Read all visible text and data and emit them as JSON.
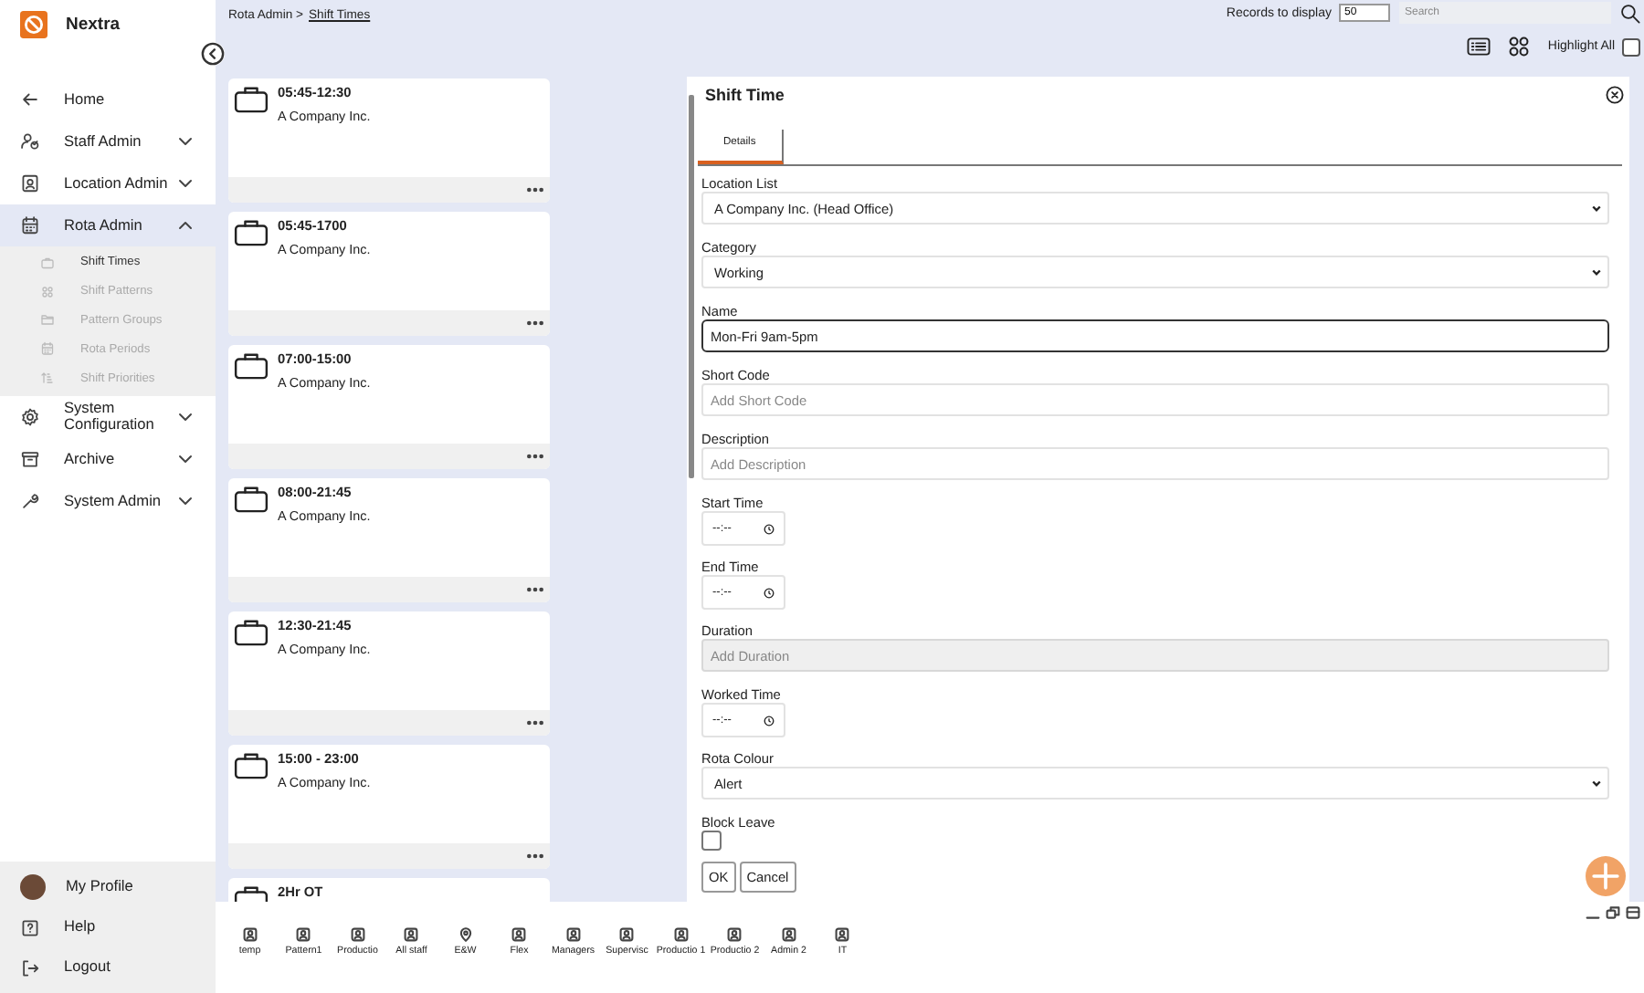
{
  "brand": {
    "name": "Nextra"
  },
  "sidebar": {
    "items": [
      {
        "label": "Home",
        "selected": false
      },
      {
        "label": "Staff Admin",
        "expanded": false,
        "selected": false
      },
      {
        "label": "Location Admin",
        "expanded": false,
        "selected": false
      },
      {
        "label": "Rota Admin",
        "expanded": true,
        "selected": true,
        "children": [
          {
            "label": "Shift Times",
            "selected": true
          },
          {
            "label": "Shift Patterns",
            "selected": false
          },
          {
            "label": "Pattern Groups",
            "selected": false
          },
          {
            "label": "Rota Periods",
            "selected": false
          },
          {
            "label": "Shift Priorities",
            "selected": false
          }
        ]
      },
      {
        "label": "System Configuration",
        "expanded": false,
        "selected": false
      },
      {
        "label": "Archive",
        "expanded": false,
        "selected": false
      },
      {
        "label": "System Admin",
        "expanded": false,
        "selected": false
      }
    ],
    "footer": [
      {
        "label": "My Profile"
      },
      {
        "label": "Help"
      },
      {
        "label": "Logout"
      }
    ]
  },
  "breadcrumb": {
    "parent": "Rota Admin >",
    "current": "Shift Times"
  },
  "toolbar": {
    "records_label": "Records to display",
    "records_value": "50",
    "search_placeholder": "Search",
    "highlight_label": "Highlight All",
    "highlight_checked": false
  },
  "shift_cards": [
    {
      "title": "05:45-12:30",
      "company": "A Company Inc."
    },
    {
      "title": "05:45-1700",
      "company": "A Company Inc."
    },
    {
      "title": "07:00-15:00",
      "company": "A Company Inc."
    },
    {
      "title": "08:00-21:45",
      "company": "A Company Inc."
    },
    {
      "title": "12:30-21:45",
      "company": "A Company Inc."
    },
    {
      "title": "15:00 - 23:00",
      "company": "A Company Inc."
    },
    {
      "title": "2Hr OT"
    }
  ],
  "panel": {
    "title": "Shift Time",
    "tabs": [
      {
        "label": "Details",
        "selected": true
      }
    ],
    "fields": [
      {
        "label": "Location List",
        "kind": "select",
        "value": "A Company Inc. (Head Office)"
      },
      {
        "label": "Category",
        "kind": "select",
        "value": "Working"
      },
      {
        "label": "Name",
        "kind": "text",
        "value": "Mon-Fri 9am-5pm",
        "focused": true
      },
      {
        "label": "Short Code",
        "kind": "text",
        "placeholder": "Add Short Code"
      },
      {
        "label": "Description",
        "kind": "text",
        "placeholder": "Add Description"
      },
      {
        "label": "Start Time",
        "kind": "time",
        "value": "--:--"
      },
      {
        "label": "End Time",
        "kind": "time",
        "value": "--:--"
      },
      {
        "label": "Duration",
        "kind": "text",
        "placeholder": "Add Duration",
        "disabled": true
      },
      {
        "label": "Worked Time",
        "kind": "time",
        "value": "--:--"
      },
      {
        "label": "Rota Colour",
        "kind": "select",
        "value": "Alert"
      },
      {
        "label": "Block Leave",
        "kind": "checkbox",
        "checked": false
      }
    ],
    "buttons": [
      "OK",
      "Cancel"
    ]
  },
  "shortcuts": [
    {
      "label": "temp",
      "kind": "person"
    },
    {
      "label": "Pattern1",
      "kind": "person"
    },
    {
      "label": "Productio",
      "kind": "person"
    },
    {
      "label": "All staff",
      "kind": "person"
    },
    {
      "label": "E&W",
      "kind": "location"
    },
    {
      "label": "Flex",
      "kind": "person"
    },
    {
      "label": "Managers",
      "kind": "person"
    },
    {
      "label": "Supervisc",
      "kind": "person"
    },
    {
      "label": "Productio 1",
      "kind": "person"
    },
    {
      "label": "Productio 2",
      "kind": "person"
    },
    {
      "label": "Admin 2",
      "kind": "person"
    },
    {
      "label": "IT",
      "kind": "person"
    }
  ]
}
